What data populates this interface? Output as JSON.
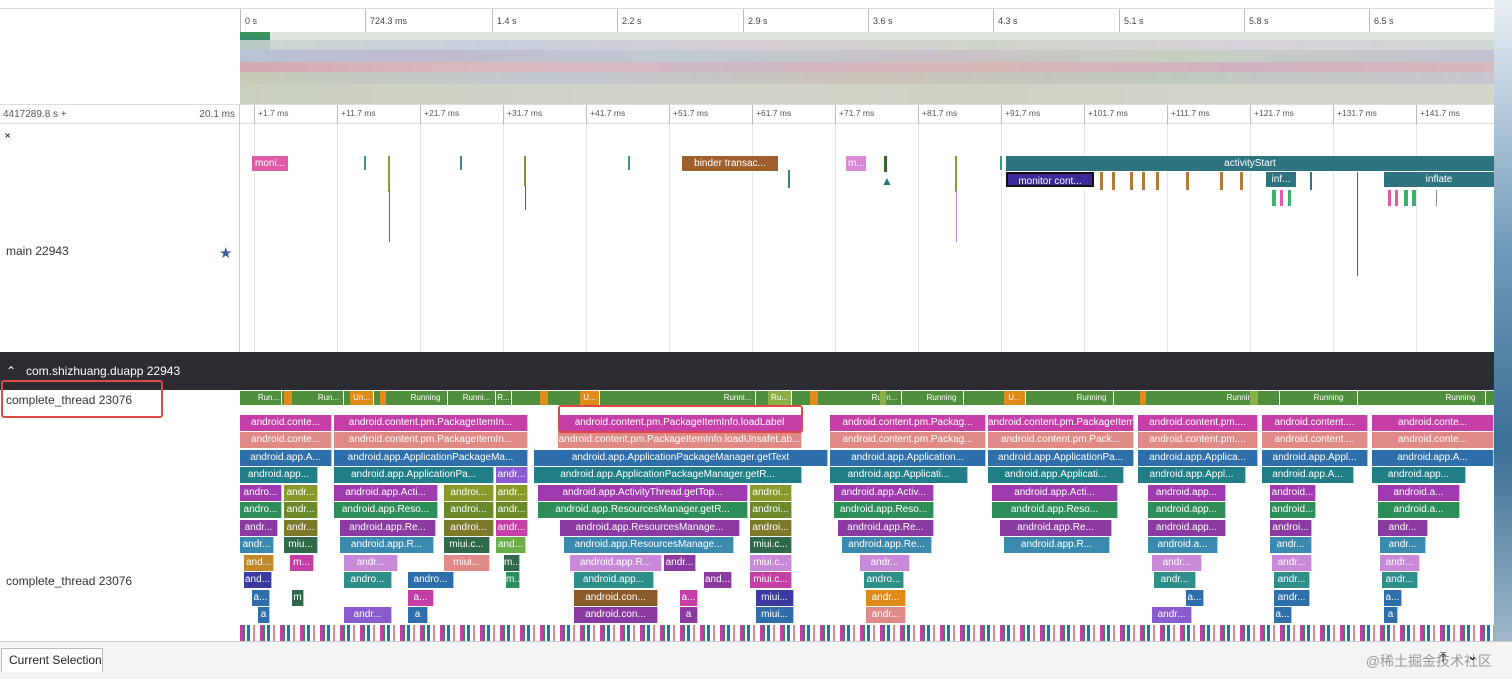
{
  "overview": {
    "ticks": [
      "0 s",
      "724.3 ms",
      "1.4 s",
      "2.2 s",
      "2.9 s",
      "3.6 s",
      "4.3 s",
      "5.1 s",
      "5.8 s",
      "6.5 s"
    ]
  },
  "timeline": {
    "range_start": "4417289.8 s +",
    "range_duration": "20.1 ms",
    "ticks": [
      "+1.7 ms",
      "+11.7 ms",
      "+21.7 ms",
      "+31.7 ms",
      "+41.7 ms",
      "+51.7 ms",
      "+61.7 ms",
      "+71.7 ms",
      "+81.7 ms",
      "+91.7 ms",
      "+101.7 ms",
      "+111.7 ms",
      "+121.7 ms",
      "+131.7 ms",
      "+141.7 ms"
    ]
  },
  "main_track": {
    "label": "main 22943",
    "slices": {
      "moni": "moni...",
      "binder": "binder transac...",
      "m": "m...",
      "activity_start": "activityStart",
      "monitor_cont": "monitor cont...",
      "inf": "inf...",
      "inflate": "inflate"
    }
  },
  "process": {
    "name": "com.shizhuang.duapp 22943"
  },
  "thread": {
    "label": "complete_thread 23076",
    "label_2": "complete_thread 23076",
    "states": [
      "Run...",
      "Run...",
      "Un...",
      "Running",
      "Runni...",
      "R...",
      "U...",
      "Runni...",
      "Ru...",
      "Runn...",
      "Running",
      "U...",
      "Running",
      "Running",
      "Running",
      "Running"
    ]
  },
  "flame": {
    "row1": [
      "android.conte...",
      "android.content.pm.PackageItemIn...",
      "android.content.pm.PackageItemInfo.loadLabel",
      "android.content.pm.Packag...",
      "android.content.pm.PackageItemIn...",
      "android.content.pm....",
      "android.content....",
      "android.conte..."
    ],
    "row2": [
      "android.conte...",
      "android.content.pm.PackageItemIn...",
      "android.content.pm.PackageItemInfo.loadUnsafeLab...",
      "android.content.pm.Packag...",
      "android.content.pm.Pack...",
      "android.content.pm....",
      "android.content....",
      "android.conte..."
    ],
    "row3": [
      "android.app.A...",
      "android.app.ApplicationPackageMa...",
      "android.app.ApplicationPackageManager.getText",
      "android.app.Application...",
      "android.app.ApplicationPa...",
      "android.app.Applica...",
      "android.app.Appl...",
      "android.app.A..."
    ],
    "row4": [
      "android.app...",
      "android.app.ApplicationPa...",
      "andr...",
      "android.app.ApplicationPackageManager.getR...",
      "android.app.Applicati...",
      "android.app.Applicati...",
      "android.app.Appl...",
      "android.app.A...",
      "android.app..."
    ],
    "row5": [
      "andro...",
      "andr...",
      "android.app.Acti...",
      "androi...",
      "andr...",
      "android.app.ActivityThread.getTop...",
      "androi...",
      "android.app.Activ...",
      "android.app.Acti...",
      "android.app...",
      "android...",
      "android.a..."
    ],
    "row6": [
      "andro...",
      "andr...",
      "android.app.Reso...",
      "androi...",
      "andr...",
      "android.app.ResourcesManager.getR...",
      "androi...",
      "android.app.Reso...",
      "android.app.Reso...",
      "android.app...",
      "android...",
      "android.a..."
    ],
    "row7": [
      "andr...",
      "andr...",
      "android.app.Re...",
      "androi...",
      "andr...",
      "android.app.ResourcesManage...",
      "androi...",
      "android.app.Re...",
      "android.app.Re...",
      "android.app...",
      "androi...",
      "andr..."
    ],
    "row8": [
      "andr...",
      "miu...",
      "android.app.R...",
      "miui.c...",
      "and...",
      "android.app.ResourcesManage...",
      "miui.c...",
      "android.app.Re...",
      "android.app.R...",
      "android.a...",
      "andr...",
      "andr..."
    ],
    "row9": [
      "and...",
      "m...",
      "andr...",
      "miui...",
      "m...",
      "android.app.R...",
      "andr...",
      "miui.c...",
      "andr...",
      "andr...",
      "andr...",
      "andr..."
    ],
    "row10": [
      "and...",
      "andro...",
      "andro...",
      "m...",
      "android.app...",
      "and...",
      "miui.c...",
      "andro...",
      "andr...",
      "andr...",
      "andr..."
    ],
    "row11": [
      "a...",
      "m",
      "a...",
      "android.con...",
      "a...",
      "miui...",
      "andr...",
      "a...",
      "andr...",
      "a..."
    ],
    "row12": [
      "a",
      "andr...",
      "a",
      "android.con...",
      "a",
      "miui...",
      "andr...",
      "andr...",
      "a...",
      "a"
    ]
  },
  "bottom": {
    "tab_current_selection": "Current Selection",
    "watermark": "@稀土掘金技术社区"
  },
  "icons": {
    "collapse": "chevron-up-icon",
    "expand": "chevron-down-icon",
    "pin": "star-icon",
    "scroll_top": "arrow-up-bar-icon",
    "collapse_panel": "chevron-down-icon"
  }
}
